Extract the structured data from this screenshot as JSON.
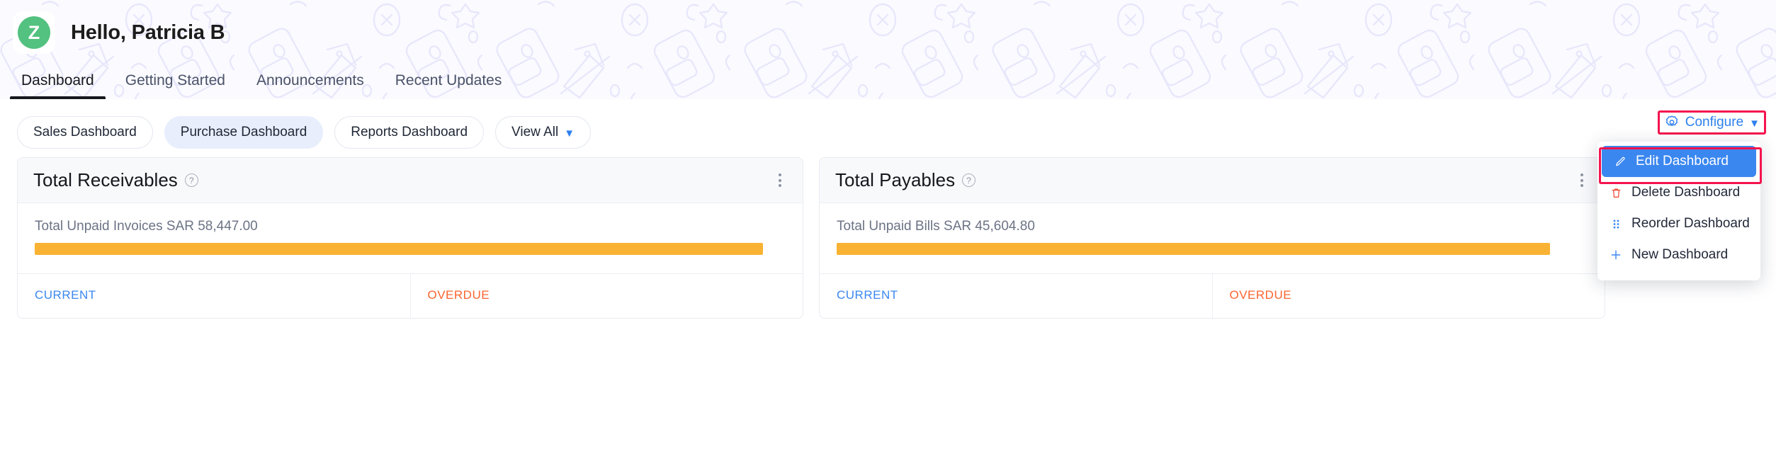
{
  "header": {
    "avatar_letter": "Z",
    "greeting": "Hello, Patricia B"
  },
  "tabs": [
    {
      "label": "Dashboard",
      "active": true
    },
    {
      "label": "Getting Started",
      "active": false
    },
    {
      "label": "Announcements",
      "active": false
    },
    {
      "label": "Recent Updates",
      "active": false
    }
  ],
  "dashboard_pills": [
    {
      "label": "Sales Dashboard",
      "selected": false,
      "has_chevron": false
    },
    {
      "label": "Purchase Dashboard",
      "selected": true,
      "has_chevron": false
    },
    {
      "label": "Reports Dashboard",
      "selected": false,
      "has_chevron": false
    },
    {
      "label": "View All",
      "selected": false,
      "has_chevron": true
    }
  ],
  "configure": {
    "label": "Configure",
    "icon": "gear-icon",
    "chevron": "chevron-down-icon",
    "accent_color": "#2f80ed",
    "highlight_color": "#f5134e"
  },
  "configure_menu": [
    {
      "label": "Edit Dashboard",
      "icon": "pencil-icon",
      "highlighted": true
    },
    {
      "label": "Delete Dashboard",
      "icon": "trash-icon",
      "highlighted": false
    },
    {
      "label": "Reorder Dashboard",
      "icon": "grid-dots-icon",
      "highlighted": false
    },
    {
      "label": "New Dashboard",
      "icon": "plus-icon",
      "highlighted": false
    }
  ],
  "cards": [
    {
      "title": "Total Receivables",
      "help_icon": "question-mark-icon",
      "menu_icon": "kebab-menu-icon",
      "summary": "Total Unpaid Invoices SAR 58,447.00",
      "bar_percent": 97,
      "bar_color": "#f9b233",
      "footer": [
        {
          "label": "CURRENT",
          "color": "#3b87f0"
        },
        {
          "label": "OVERDUE",
          "color": "#fa6530"
        }
      ]
    },
    {
      "title": "Total Payables",
      "help_icon": "question-mark-icon",
      "menu_icon": "kebab-menu-icon",
      "summary": "Total Unpaid Bills SAR 45,604.80",
      "bar_percent": 95,
      "bar_color": "#f9b233",
      "footer": [
        {
          "label": "CURRENT",
          "color": "#3b87f0"
        },
        {
          "label": "OVERDUE",
          "color": "#fa6530"
        }
      ]
    }
  ]
}
